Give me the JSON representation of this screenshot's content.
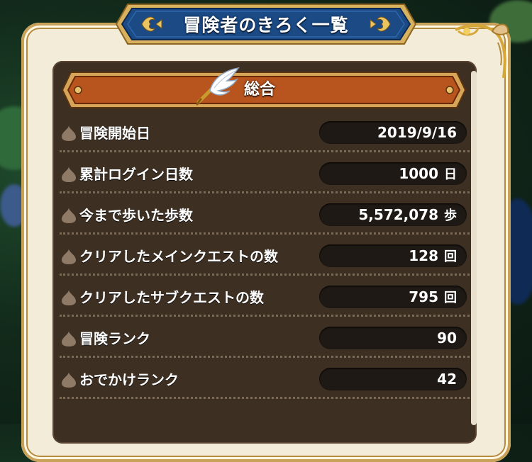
{
  "title": "冒険者のきろく一覧",
  "section": {
    "title": "総合"
  },
  "rows": [
    {
      "label": "冒険開始日",
      "value": "2019/9/16",
      "unit": ""
    },
    {
      "label": "累計ログイン日数",
      "value": "1000",
      "unit": "日"
    },
    {
      "label": "今まで歩いた歩数",
      "value": "5,572,078",
      "unit": "歩"
    },
    {
      "label": "クリアしたメインクエストの数",
      "value": "128",
      "unit": "回"
    },
    {
      "label": "クリアしたサブクエストの数",
      "value": "795",
      "unit": "回"
    },
    {
      "label": "冒険ランク",
      "value": "90",
      "unit": ""
    },
    {
      "label": "おでかけランク",
      "value": "42",
      "unit": ""
    }
  ],
  "colors": {
    "panel": "#f3ecd8",
    "content": "#3d2f22",
    "banner": "#1b4a85",
    "section_header": "#b8541e",
    "value_box": "#1e1914"
  },
  "icons": {
    "row": "slime-icon",
    "section": "wing-pen-icon",
    "title": "fleur-de-lis-icon"
  }
}
